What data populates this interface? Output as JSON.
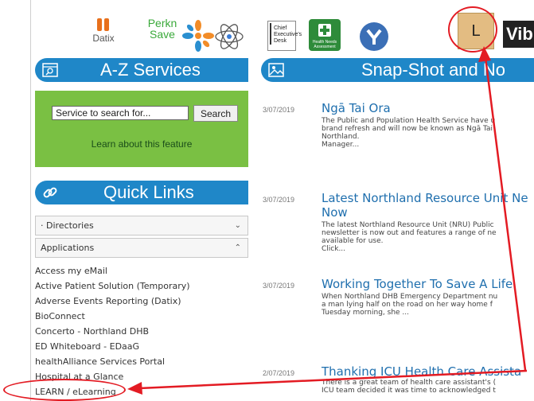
{
  "apps": {
    "datix_label": "Datix",
    "perkn_label": "Perkn\nSave",
    "ced_label": "Chief\nExecutive's\nDesk",
    "hna_label": "Health Needs Assessment",
    "learn_label": "L",
    "vib_label": "Vib"
  },
  "az": {
    "title": "A-Z Services"
  },
  "search": {
    "placeholder": "Service to search for...",
    "value": "Service to search for...",
    "button": "Search",
    "learn_link": "Learn about this feature"
  },
  "quicklinks": {
    "title": "Quick Links",
    "directories": "· Directories",
    "applications": "Applications",
    "items": [
      "Access my eMail",
      "Active Patient Solution (Temporary)",
      "Adverse Events Reporting (Datix)",
      "BioConnect",
      "Concerto - Northland DHB",
      "ED Whiteboard - EDaaG",
      "healthAlliance Services Portal",
      "Hospital at a Glance",
      "LEARN / eLearning"
    ]
  },
  "snap": {
    "title": "Snap-Shot and No"
  },
  "news": [
    {
      "date": "3/07/2019",
      "title": "Ngā Tai Ora",
      "body": "The Public and Population Health Service have u\nbrand refresh and will now be known as Ngā Tai\nNorthland.\nManager..."
    },
    {
      "date": "3/07/2019",
      "title": "Latest Northland Resource Unit Ne Now",
      "body": "The latest Northland Resource Unit (NRU) Public\nnewsletter is now out and features a range of ne\navailable for use.\nClick..."
    },
    {
      "date": "3/07/2019",
      "title": "Working Together To Save A Life",
      "body": "When Northland DHB Emergency Department nu\na man lying half on the road on her way home f\nTuesday morning, she ..."
    },
    {
      "date": "2/07/2019",
      "title": "Thanking ICU Health Care Assista",
      "body": "There is a great team of health care assistant's (\nICU team decided it was time to acknowledged t"
    }
  ],
  "colors": {
    "header_blue": "#1f87c8",
    "search_green": "#7ac043",
    "annotation_red": "#e31b23",
    "link_blue": "#1f6fae"
  }
}
